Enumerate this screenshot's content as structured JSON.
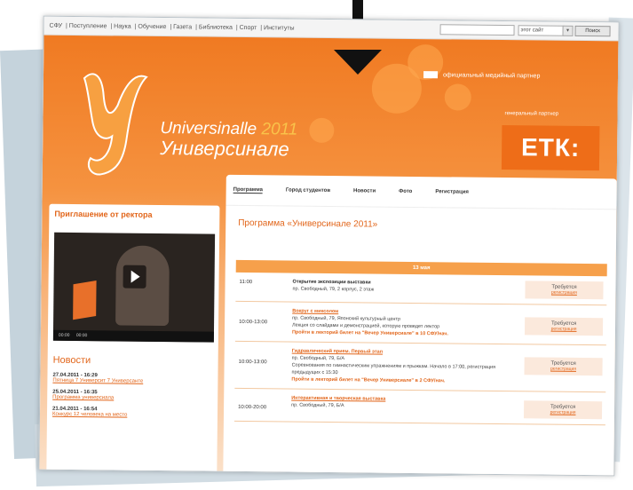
{
  "header_nav": [
    "СФУ",
    "Поступление",
    "Наука",
    "Обучение",
    "Газета",
    "Библиотека",
    "Спорт",
    "Институты"
  ],
  "site_select": "этот сайт",
  "search_button": "Поиск",
  "media_partner": "официальный медийный партнер",
  "partner_label": "генеральный партнер",
  "partner_logo": "ЕТК:",
  "brand_line1": "Universinalle",
  "brand_year": "2011",
  "brand_line2": "Универсинале",
  "invite_title": "Приглашение от ректора",
  "video_controls": [
    "00:00",
    "00:00"
  ],
  "news": {
    "title": "Новости",
    "items": [
      {
        "date": "27.04.2011 - 16:29",
        "link": "Пятница 7 Университ 7 Универсанте"
      },
      {
        "date": "25.04.2011 - 16:35",
        "link": "Программа универсиала"
      },
      {
        "date": "21.04.2011 - 16:54",
        "link": "Конкурс 12 человека на место"
      }
    ]
  },
  "tabs": [
    "Программа",
    "Город студентов",
    "Новости",
    "Фото",
    "Регистрация"
  ],
  "program_title": "Программа «Универсинале 2011»",
  "table_date": "13 мая",
  "rows": [
    {
      "time": "11:00",
      "title": "Открытие экспозиции выставки",
      "place": "пр. Свободный, 79, 2 корпус, 2 этаж",
      "desc": "",
      "note": "",
      "need": "Требуется",
      "reg": "регистрация"
    },
    {
      "time": "10:00-13:00",
      "title": "Вокруг с миксолом",
      "place": "пр. Свободный, 79, Японский культурный центр",
      "desc": "Лекция со слайдами и демонстрацией, которую проведет лектор",
      "note": "Пройти в лекторий билет на \"Вечер Универсиале\" в 10 СФУ/нач.",
      "need": "Требуется",
      "reg": "регистрация"
    },
    {
      "time": "10:00-13:00",
      "title": "Гидравлический прием. Первый этап",
      "place": "пр. Свободный, 79, Б/А",
      "desc": "Соревнования по гимнастическим упражнениям и прыжкам. Начало в 17:00, регистрация предыдущих с 15:30",
      "note": "Пройти в лекторий билет на \"Вечер Универсиале\" в 2 СФУ/нач.",
      "need": "Требуется",
      "reg": "регистрация"
    },
    {
      "time": "10:00-20:00",
      "title": "Интерактивная и творческая выставка",
      "place": "пр. Свободный, 79, Б/А",
      "desc": "",
      "note": "",
      "need": "Требуется",
      "reg": "регистрация"
    }
  ]
}
